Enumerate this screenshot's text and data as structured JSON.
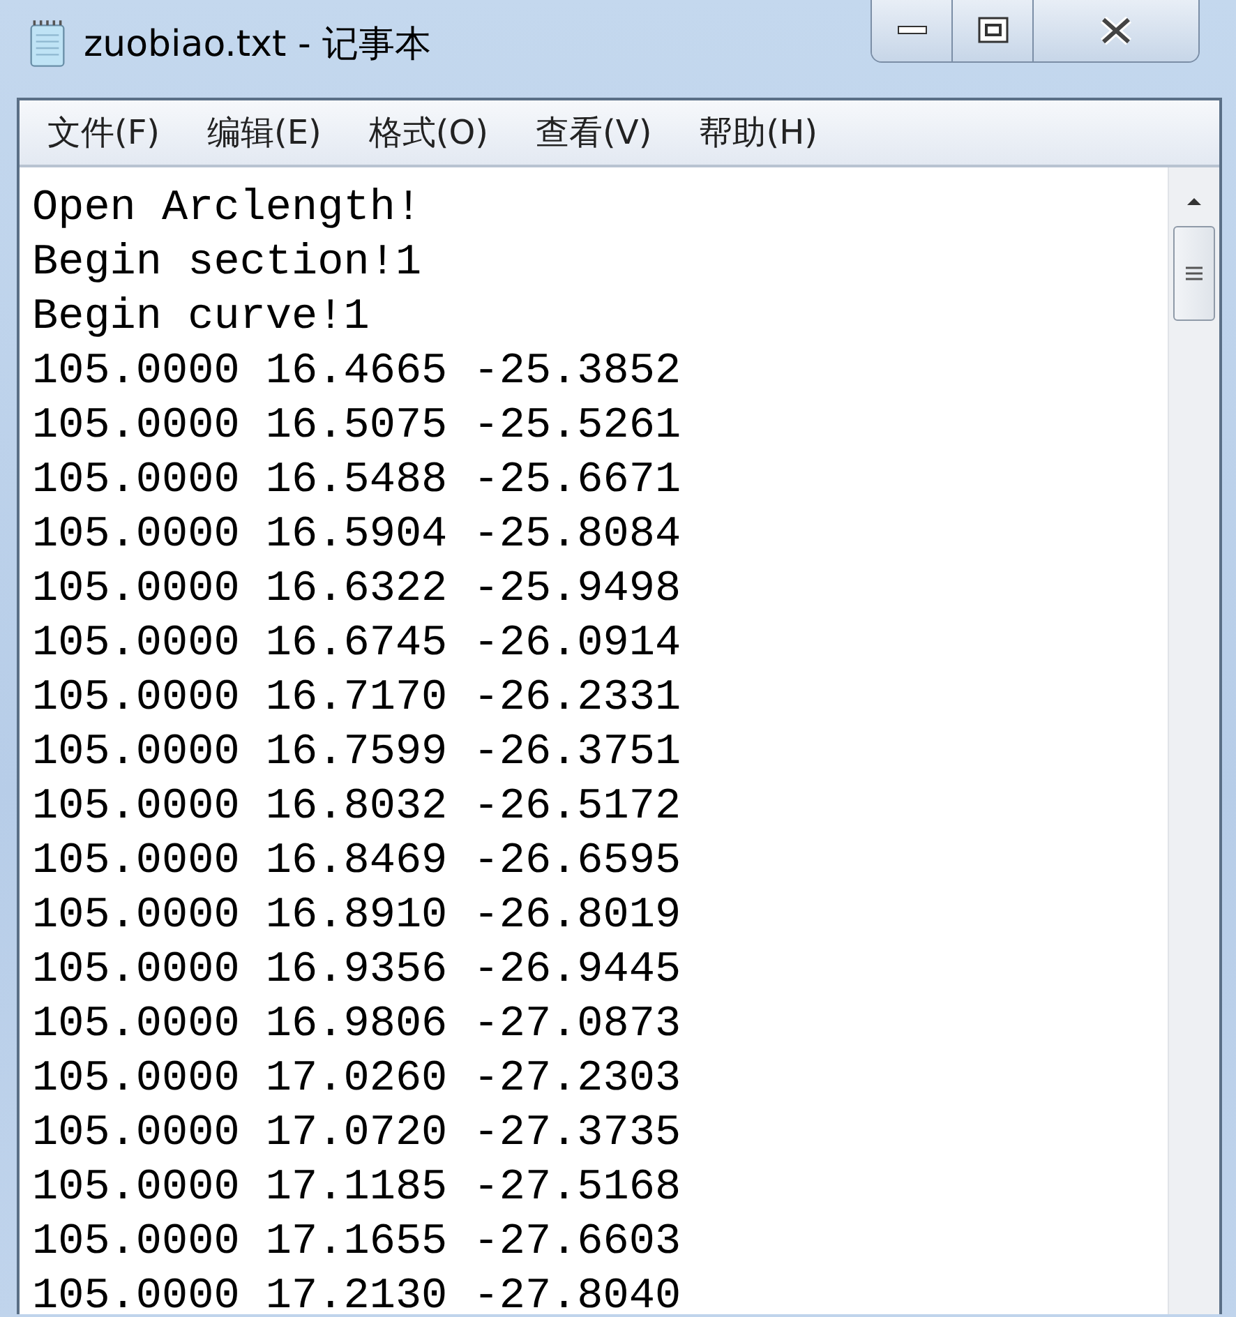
{
  "window": {
    "title": "zuobiao.txt - 记事本"
  },
  "menu": [
    "文件(F)",
    "编辑(E)",
    "格式(O)",
    "查看(V)",
    "帮助(H)"
  ],
  "lines": [
    "Open Arclength!",
    "Begin section!1",
    "Begin curve!1",
    "105.0000 16.4665 -25.3852",
    "105.0000 16.5075 -25.5261",
    "105.0000 16.5488 -25.6671",
    "105.0000 16.5904 -25.8084",
    "105.0000 16.6322 -25.9498",
    "105.0000 16.6745 -26.0914",
    "105.0000 16.7170 -26.2331",
    "105.0000 16.7599 -26.3751",
    "105.0000 16.8032 -26.5172",
    "105.0000 16.8469 -26.6595",
    "105.0000 16.8910 -26.8019",
    "105.0000 16.9356 -26.9445",
    "105.0000 16.9806 -27.0873",
    "105.0000 17.0260 -27.2303",
    "105.0000 17.0720 -27.3735",
    "105.0000 17.1185 -27.5168",
    "105.0000 17.1655 -27.6603",
    "105.0000 17.2130 -27.8040"
  ]
}
